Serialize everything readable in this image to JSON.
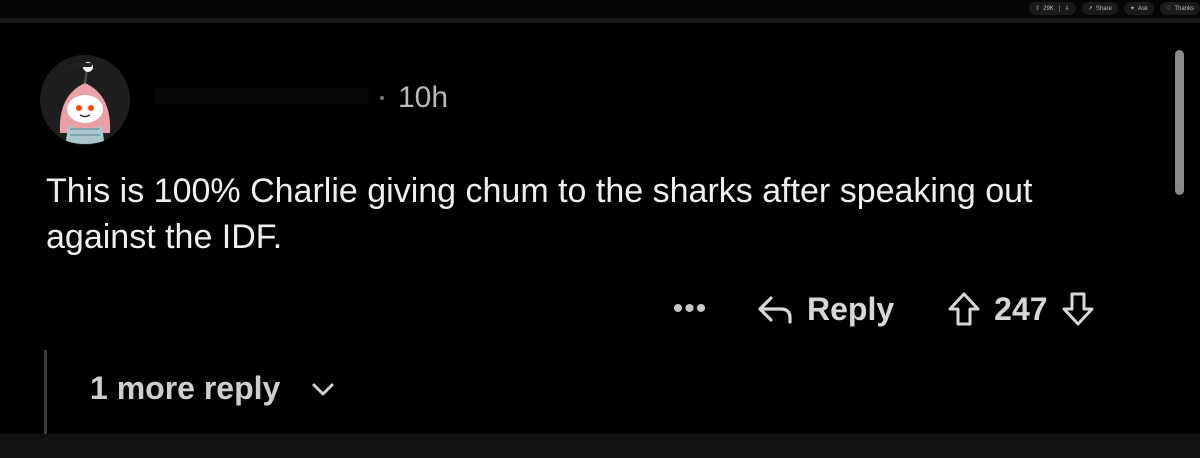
{
  "top_bar": {
    "votes_count": "29K",
    "share_label": "Share",
    "ask_label": "Ask",
    "thanks_label": "Thanks"
  },
  "comment": {
    "timestamp": "10h",
    "body": "This is 100% Charlie giving chum to the sharks after speaking out against the IDF.",
    "actions": {
      "more_label": "•••",
      "reply_label": "Reply",
      "vote_count": "247"
    },
    "more_replies_label": "1 more reply"
  },
  "colors": {
    "background": "#000000",
    "text_primary": "#efefef",
    "text_muted": "#b9b9b9",
    "avatar_pink": "#f0a0a8",
    "avatar_orange": "#ff4500"
  },
  "icons": {
    "reply": "reply-arrow-icon",
    "upvote": "upvote-arrow-icon",
    "downvote": "downvote-arrow-icon",
    "expand": "chevron-down-icon"
  }
}
